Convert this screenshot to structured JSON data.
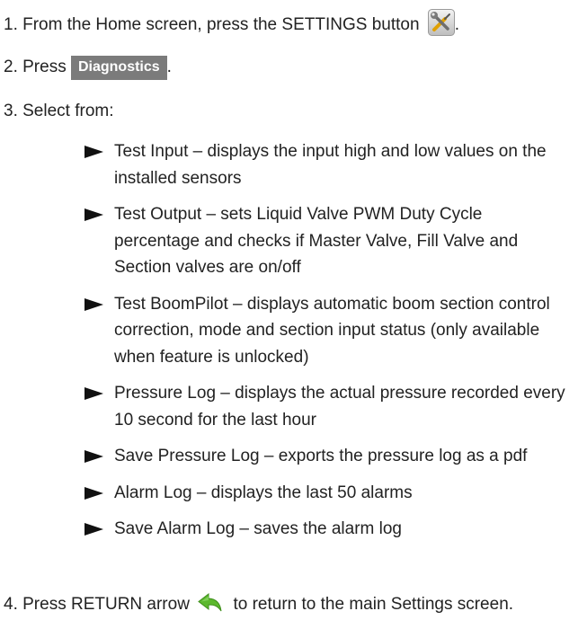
{
  "steps": {
    "s1_prefix": "1. From the Home screen, press the SETTINGS button",
    "s1_suffix": ".",
    "s2_prefix": "2. Press",
    "s2_button": "Diagnostics",
    "s2_suffix": ".",
    "s3": "3. Select from:",
    "s4_prefix": "4. Press RETURN arrow",
    "s4_suffix": "to return to the main Settings screen."
  },
  "icons": {
    "settings": "settings-tools-icon",
    "return": "return-arrow-icon",
    "bullet": "triangle-bullet-icon"
  },
  "colors": {
    "diagnostics_button_bg": "#7b7b7b",
    "return_arrow": "#5cb82d",
    "settings_icon_bg": "#d8d8d8"
  },
  "items": [
    "Test Input – displays the input high and low values on the installed sensors",
    "Test Output – sets Liquid Valve PWM Duty Cycle percentage and checks if Master Valve, Fill Valve and Section valves are on/off",
    "Test BoomPilot – displays automatic boom section control correction, mode and section input status (only available when feature is unlocked)",
    "Pressure Log – displays the actual pressure recorded every 10 second for the last hour",
    "Save Pressure Log – exports the pressure log as a pdf",
    "Alarm Log – displays the last 50 alarms",
    "Save Alarm Log – saves the alarm log"
  ]
}
